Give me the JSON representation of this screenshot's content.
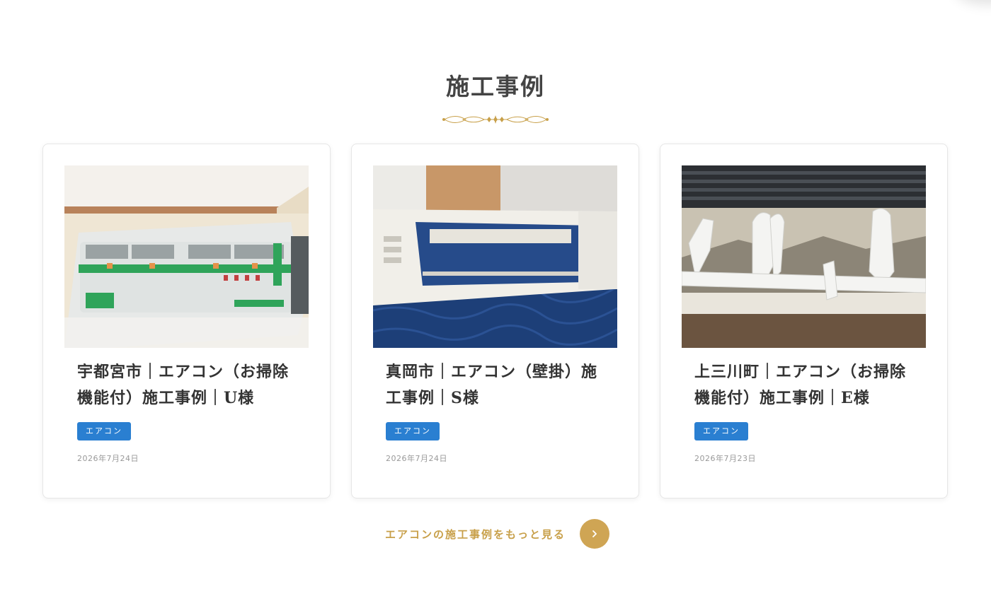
{
  "section": {
    "title": "施工事例"
  },
  "cards": [
    {
      "title": "宇都宮市｜エアコン（お掃除機能付）施工事例｜U様",
      "tag": "エアコン",
      "date": "2026年7月24日",
      "image": "aircon-wrapped-in-plastic"
    },
    {
      "title": "真岡市｜エアコン（壁掛）施工事例｜S様",
      "tag": "エアコン",
      "date": "2026年7月24日",
      "image": "aircon-panel-on-blue-blanket"
    },
    {
      "title": "上三川町｜エアコン（お掃除機能付）施工事例｜E様",
      "tag": "エアコン",
      "date": "2026年7月23日",
      "image": "aircon-louver-parts-closeup"
    }
  ],
  "more": {
    "label": "エアコンの施工事例をもっと見る",
    "icon": "chevron-right-icon"
  },
  "colors": {
    "accent_gold": "#c8a04a",
    "tag_blue": "#2a7fd1"
  }
}
